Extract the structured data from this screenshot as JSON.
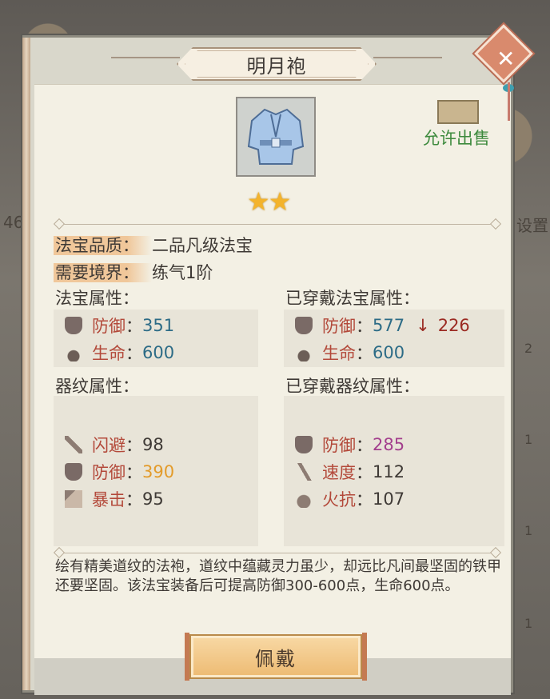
{
  "background": {
    "side_text_count": "46",
    "side_text_setting": "设置",
    "side_numbers": [
      "2",
      "1",
      "1",
      "1"
    ]
  },
  "dialog": {
    "title": "明月袍",
    "close_icon": "close-x-icon",
    "item_icon": "robe-icon",
    "star_count": 2,
    "stars": "★★",
    "sell_label": "允许出售",
    "quality_label": "法宝品质：",
    "quality_value": "二品凡级法宝",
    "realm_label": "需要境界：",
    "realm_value": "练气1阶",
    "treasure_attrs_title": "法宝属性：",
    "equipped_attrs_title": "已穿戴法宝属性：",
    "pattern_attrs_title": "器纹属性：",
    "equipped_pattern_title": "已穿戴器纹属性：",
    "treasure_attrs": [
      {
        "name": "防御",
        "colon": "：",
        "value": "351"
      },
      {
        "name": "生命",
        "colon": "：",
        "value": "600"
      }
    ],
    "equipped_attrs": [
      {
        "name": "防御",
        "colon": "：",
        "value": "577",
        "arrow": "↓",
        "diff": "226"
      },
      {
        "name": "生命",
        "colon": "：",
        "value": "600"
      }
    ],
    "pattern_attrs": [
      {
        "name": "闪避",
        "colon": "：",
        "value": "98"
      },
      {
        "name": "防御",
        "colon": "：",
        "value": "390"
      },
      {
        "name": "暴击",
        "colon": "：",
        "value": "95"
      }
    ],
    "equipped_pattern_attrs": [
      {
        "name": "防御",
        "colon": "：",
        "value": "285"
      },
      {
        "name": "速度",
        "colon": "：",
        "value": "112"
      },
      {
        "name": "火抗",
        "colon": "：",
        "value": "107"
      }
    ],
    "description": "绘有精美道纹的法袍，道纹中蕴藏灵力虽少，却远比凡间最坚固的铁甲还要坚固。该法宝装备后可提高防御300-600点，生命600点。",
    "equip_button": "佩戴"
  },
  "colors": {
    "attr_name": "#b3493a",
    "value_blue": "#2c6b86",
    "value_orange": "#e39b2a",
    "value_purple": "#a33f8d",
    "sell_green": "#3d8a3d",
    "star_gold": "#f3b32c"
  }
}
